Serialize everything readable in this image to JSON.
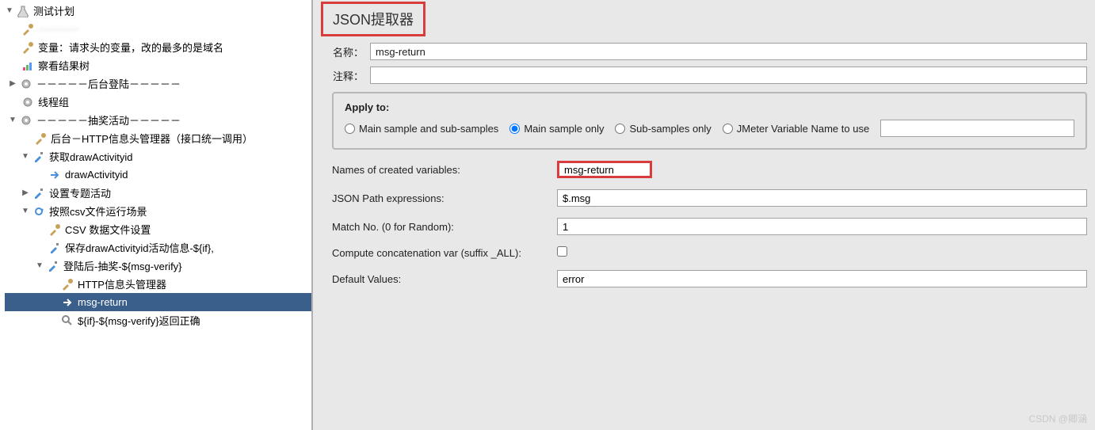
{
  "tree": {
    "root": "测试计划",
    "blurred": "············",
    "var_item": "变量：请求头的变量，改的最多的是域名",
    "view_results": "察看结果树",
    "sep_login": "－－－－－后台登陆－－－－－",
    "thread_group": "线程组",
    "sep_lottery": "－－－－－抽奖活动－－－－－",
    "http_header_mgr1": "后台－HTTP信息头管理器（接口统一调用）",
    "get_draw": "获取drawActivityid",
    "draw_id": "drawActivityid",
    "set_topic": "设置专题活动",
    "csv_scene": "按照csv文件运行场景",
    "csv_data": "CSV 数据文件设置",
    "save_draw": "保存drawActivityid活动信息-${if},",
    "login_after": "登陆后-抽奖-${msg-verify}",
    "http_header_mgr2": "HTTP信息头管理器",
    "msg_return": "msg-return",
    "verify_correct": "${if}-${msg-verify}返回正确"
  },
  "panel": {
    "title": "JSON提取器",
    "name_label": "名称：",
    "name_value": "msg-return",
    "comment_label": "注释：",
    "comment_value": "",
    "apply_to": "Apply to:",
    "radio1": "Main sample and sub-samples",
    "radio2": "Main sample only",
    "radio3": "Sub-samples only",
    "radio4": "JMeter Variable Name to use",
    "radio4_value": "",
    "names_label": "Names of created variables:",
    "names_value": "msg-return",
    "jsonpath_label": "JSON Path expressions:",
    "jsonpath_value": "$.msg",
    "matchno_label": "Match No. (0 for Random):",
    "matchno_value": "1",
    "concat_label": "Compute concatenation var (suffix _ALL):",
    "default_label": "Default Values:",
    "default_value": "error"
  },
  "watermark": "CSDN @卿涵"
}
